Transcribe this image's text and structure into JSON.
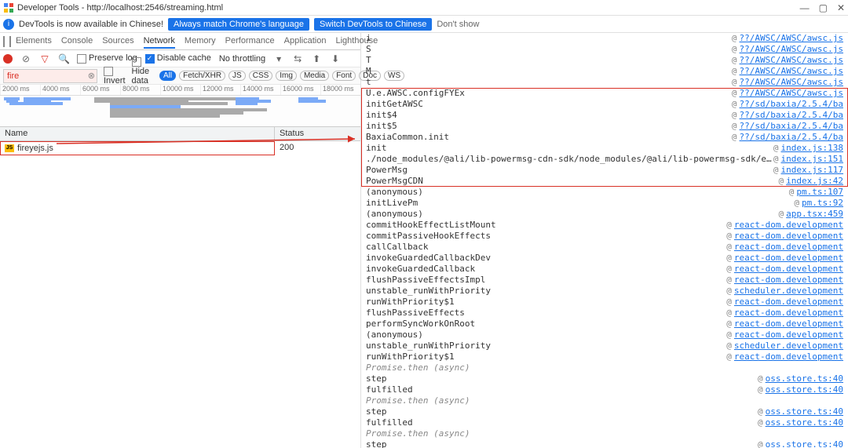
{
  "window": {
    "title": "Developer Tools - http://localhost:2546/streaming.html"
  },
  "info_bar": {
    "text": "DevTools is now available in Chinese!",
    "btn1": "Always match Chrome's language",
    "btn2": "Switch DevTools to Chinese",
    "dont_show": "Don't show"
  },
  "tabs": [
    "Elements",
    "Console",
    "Sources",
    "Network",
    "Memory",
    "Performance",
    "Application",
    "Lighthouse"
  ],
  "active_tab": 3,
  "toolbar": {
    "preserve_log": "Preserve log",
    "disable_cache": "Disable cache",
    "throttling": "No throttling"
  },
  "filter": {
    "value": "fire",
    "invert": "Invert",
    "hide_data": "Hide data URLs",
    "types": [
      "All",
      "Fetch/XHR",
      "JS",
      "CSS",
      "Img",
      "Media",
      "Font",
      "Doc",
      "WS"
    ]
  },
  "timeline_labels": [
    "2000 ms",
    "4000 ms",
    "6000 ms",
    "8000 ms",
    "10000 ms",
    "12000 ms",
    "14000 ms",
    "16000 ms",
    "18000 ms"
  ],
  "columns": {
    "name": "Name",
    "status": "Status"
  },
  "resources": [
    {
      "name": "fireyejs.js",
      "status": "200"
    }
  ],
  "stack": [
    {
      "fn": "i",
      "at": "??/AWSC/AWSC/awsc.js"
    },
    {
      "fn": "S",
      "at": "??/AWSC/AWSC/awsc.js"
    },
    {
      "fn": "T",
      "at": "??/AWSC/AWSC/awsc.js"
    },
    {
      "fn": "M",
      "at": "??/AWSC/AWSC/awsc.js"
    },
    {
      "fn": "t",
      "at": "??/AWSC/AWSC/awsc.js"
    },
    {
      "fn": "U.e.AWSC.configFYEx",
      "at": "??/AWSC/AWSC/awsc.js"
    },
    {
      "fn": "initGetAWSC",
      "at": "??/sd/baxia/2.5.4/ba"
    },
    {
      "fn": "init$4",
      "at": "??/sd/baxia/2.5.4/ba"
    },
    {
      "fn": "init$5",
      "at": "??/sd/baxia/2.5.4/ba"
    },
    {
      "fn": "BaxiaCommon.init",
      "at": "??/sd/baxia/2.5.4/ba"
    },
    {
      "fn": "init",
      "at": "index.js:138"
    },
    {
      "fn": "./node_modules/@ali/lib-powermsg-cdn-sdk/node_modules/@ali/lib-powermsg-sdk/es/index.js.PowerMsg.initBaXia",
      "at": "index.js:151"
    },
    {
      "fn": "PowerMsg",
      "at": "index.js:117"
    },
    {
      "fn": "PowerMsgCDN",
      "at": "index.js:42"
    },
    {
      "fn": "(anonymous)",
      "at": "pm.ts:107"
    },
    {
      "fn": "initLivePm",
      "at": "pm.ts:92"
    },
    {
      "fn": "(anonymous)",
      "at": "app.tsx:459"
    },
    {
      "fn": "commitHookEffectListMount",
      "at": "react-dom.development"
    },
    {
      "fn": "commitPassiveHookEffects",
      "at": "react-dom.development"
    },
    {
      "fn": "callCallback",
      "at": "react-dom.development"
    },
    {
      "fn": "invokeGuardedCallbackDev",
      "at": "react-dom.development"
    },
    {
      "fn": "invokeGuardedCallback",
      "at": "react-dom.development"
    },
    {
      "fn": "flushPassiveEffectsImpl",
      "at": "react-dom.development"
    },
    {
      "fn": "unstable_runWithPriority",
      "at": "scheduler.development"
    },
    {
      "fn": "runWithPriority$1",
      "at": "react-dom.development"
    },
    {
      "fn": "flushPassiveEffects",
      "at": "react-dom.development"
    },
    {
      "fn": "performSyncWorkOnRoot",
      "at": "react-dom.development"
    },
    {
      "fn": "(anonymous)",
      "at": "react-dom.development"
    },
    {
      "fn": "unstable_runWithPriority",
      "at": "scheduler.development"
    },
    {
      "fn": "runWithPriority$1",
      "at": "react-dom.development"
    },
    {
      "fn": "Promise.then (async)",
      "at": "",
      "italic": true
    },
    {
      "fn": "step",
      "at": "oss.store.ts:40"
    },
    {
      "fn": "fulfilled",
      "at": "oss.store.ts:40"
    },
    {
      "fn": "Promise.then (async)",
      "at": "",
      "italic": true
    },
    {
      "fn": "step",
      "at": "oss.store.ts:40"
    },
    {
      "fn": "fulfilled",
      "at": "oss.store.ts:40"
    },
    {
      "fn": "Promise.then (async)",
      "at": "",
      "italic": true
    },
    {
      "fn": "step",
      "at": "oss.store.ts:40"
    }
  ]
}
